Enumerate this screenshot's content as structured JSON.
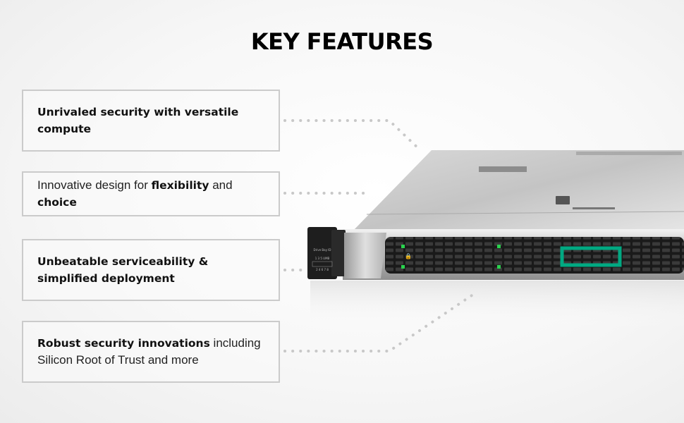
{
  "heading": "KEY FEATURES",
  "features": [
    {
      "bold": "Unrivaled security with versatile compute"
    },
    {
      "pre": "Innovative design for ",
      "b1": "flexibility",
      "mid": " and ",
      "b2": "choice"
    },
    {
      "bold": "Unbeatable serviceability & simplified deployment"
    },
    {
      "bold": "Robust security innovations",
      "rest": " including Silicon Root of Trust and more"
    }
  ],
  "server": {
    "drive_bay_label": "Drive Bay ID",
    "bay_numbers_top": "1 3 5 UMB",
    "bay_numbers_bottom": "2 4 6 7 8",
    "accent_color": "#01a982",
    "led_color": "#2ad24e"
  },
  "connector_color": "#c8c8c8"
}
